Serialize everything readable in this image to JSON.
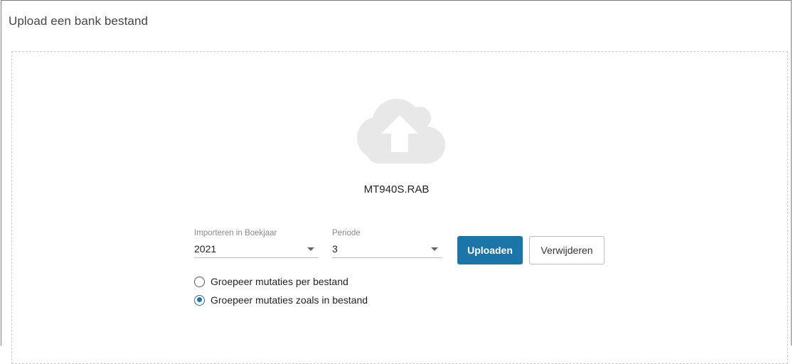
{
  "panel": {
    "title": "Upload een bank bestand"
  },
  "dropzone": {
    "icon": "cloud-upload-icon",
    "filename": "MT940S.RAB"
  },
  "form": {
    "year": {
      "label": "Importeren in Boekjaar",
      "value": "2021"
    },
    "period": {
      "label": "Periode",
      "value": "3"
    },
    "upload_label": "Uploaden",
    "remove_label": "Verwijderen",
    "grouping": [
      {
        "label": "Groepeer mutaties per bestand",
        "checked": false
      },
      {
        "label": "Groepeer mutaties zoals in bestand",
        "checked": true
      }
    ]
  },
  "colors": {
    "primary": "#1b75a8",
    "cloud": "#e8e8e8"
  }
}
